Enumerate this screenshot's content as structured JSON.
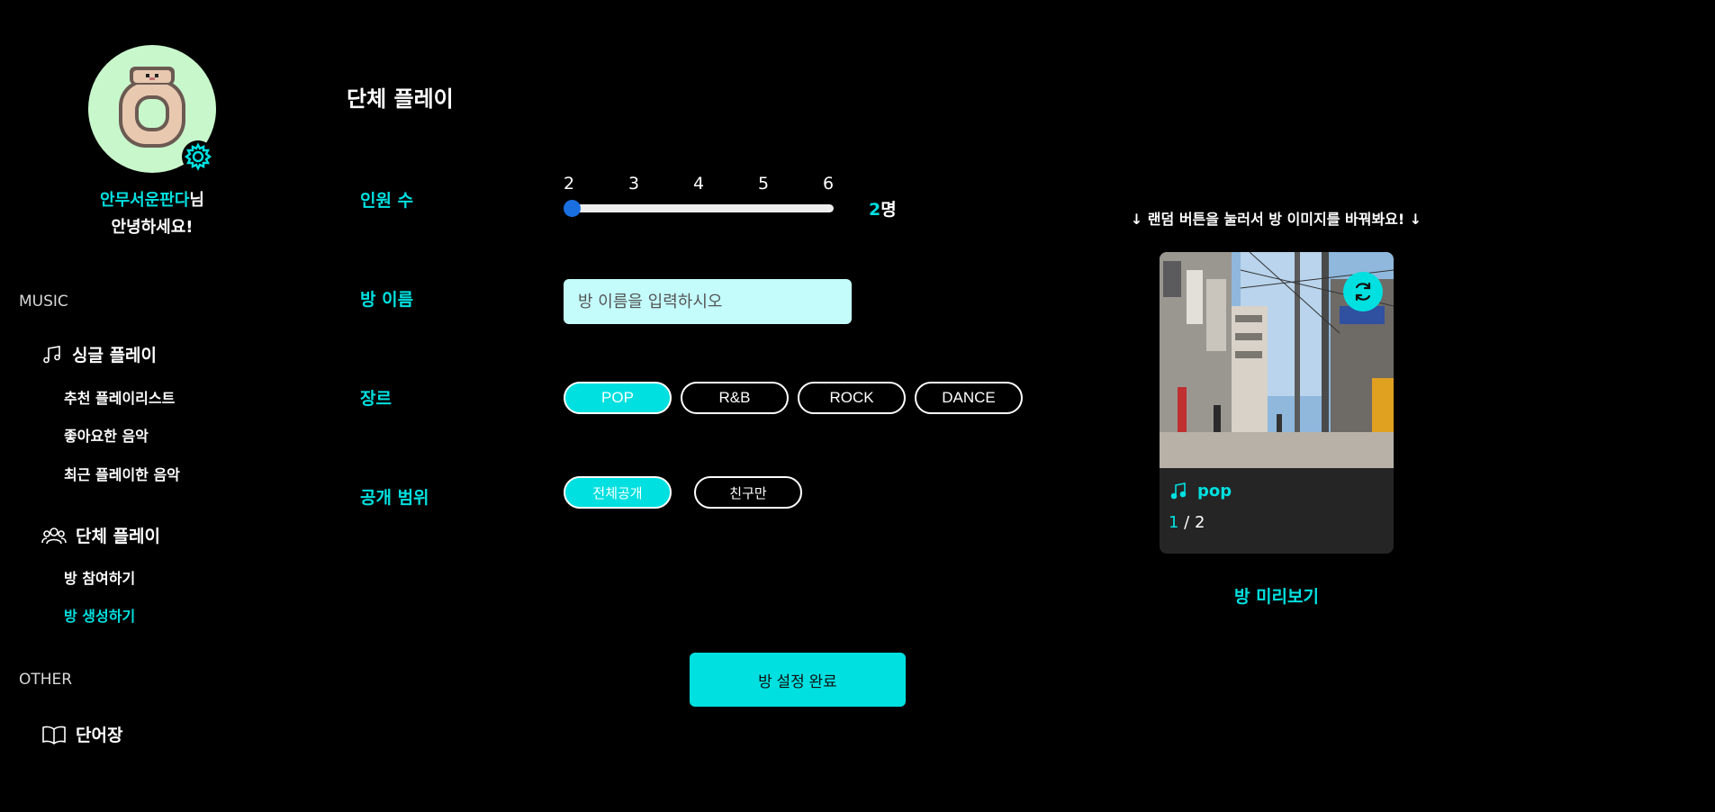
{
  "sidebar": {
    "user_name": "안무서운판다",
    "user_suffix": "님",
    "greeting": "안녕하세요!",
    "music_label": "MUSIC",
    "single_play": "싱글 플레이",
    "single_items": [
      "추천 플레이리스트",
      "좋아요한 음악",
      "최근 플레이한 음악"
    ],
    "group_play": "단체 플레이",
    "group_items": [
      "방 참여하기",
      "방 생성하기"
    ],
    "other_label": "OTHER",
    "vocab": "단어장"
  },
  "main": {
    "title": "단체 플레이",
    "labels": {
      "members": "인원 수",
      "room_name": "방 이름",
      "genre": "장르",
      "visibility": "공개 범위"
    },
    "slider": {
      "ticks": [
        "2",
        "3",
        "4",
        "5",
        "6"
      ],
      "value": "2",
      "unit": "명"
    },
    "room_input": {
      "placeholder": "방 이름을 입력하시오",
      "value": ""
    },
    "genres": [
      "POP",
      "R&B",
      "ROCK",
      "DANCE"
    ],
    "selected_genre": "POP",
    "visibility_options": [
      "전체공개",
      "친구만"
    ],
    "selected_visibility": "전체공개",
    "submit": "방 설정 완료"
  },
  "preview": {
    "hint": "↓ 랜덤 버튼을 눌러서 방 이미지를 바꿔봐요! ↓",
    "genre": "pop",
    "current": "1",
    "separator": " / ",
    "max": "2",
    "label": "방 미리보기"
  },
  "colors": {
    "accent": "#00e0e0",
    "background": "#000000",
    "input_bg": "#c4fcfc",
    "card_bg": "#252525",
    "slider_thumb": "#1a6fe0"
  }
}
